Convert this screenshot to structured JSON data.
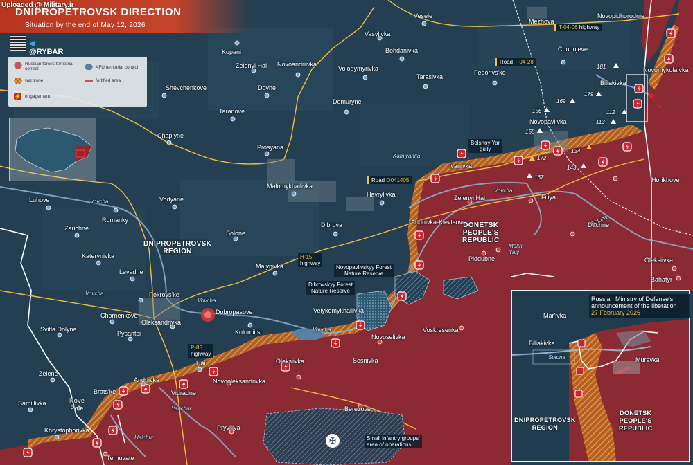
{
  "header": {
    "title": "DNIPROPETROVSK DIRECTION",
    "subtitle": "Situation by the end of May 12, 2026"
  },
  "watermark": "Uploaded @ Military.ir",
  "brand": {
    "handle": "@RYBAR",
    "icon": "telegram-icon"
  },
  "legend": {
    "russian_forces": "Russian forces territorial control",
    "afu": "AFU territorial control",
    "war_zone": "war zone",
    "fortified": "fortified area",
    "engagement": "engagement"
  },
  "colors": {
    "russian": "#8b2a33",
    "afu": "#243f51",
    "war_zone": "#d98a2b",
    "roads": "#f0c040",
    "header": "#c5432a"
  },
  "settlements": {
    "vesele": "Vesele",
    "mezhova": "Mezhova",
    "novopidhorodnie": "Novopidhorodnie",
    "vasylivka": "Vasylivka",
    "kopani": "Kopani",
    "bohdanivka": "Bohdanivka",
    "chuhujeve": "Chuhujeve",
    "novomykolaivka": "Novomykolaivka",
    "zelenyi_hai_n": "Zelenyi Hai",
    "novoandriivka": "Novoandriivka",
    "volodymyrivka": "Volodymyrivka",
    "fedorivs_ke": "Fedorivs'ke",
    "tarasivka": "Tarasivka",
    "biliakivka": "Biliakivka",
    "shevchenkove": "Shevchenkove",
    "dovhe": "Dovhe",
    "demuryne": "Demuryne",
    "taranove": "Taranove",
    "novopavlivka": "Novopavlivka",
    "chaplyne": "Chaplyne",
    "prosyana": "Prosyana",
    "ivanivka": "Ivanivka",
    "horikhove": "Horikhove",
    "malomykhailivka": "Malomykhailivka",
    "havrylivka": "Havrylivka",
    "zelenyi_hai_s": "Zelenyi Hai",
    "filiya": "Filiya",
    "luhove": "Luhove",
    "vodyane": "Vodyane",
    "romanky": "Romanky",
    "zarichne": "Zarichne",
    "solone": "Solone",
    "dibrova": "Dibrova",
    "andriivka_klevtsove": "Andriivka-Klevtsove",
    "dachne": "Dachne",
    "katerynivka": "Katerynivka",
    "malynivka": "Malynivka",
    "oleksiivka_e": "Oleksiivka",
    "levadne": "Levadne",
    "piddubne": "Piddubne",
    "bahatyr": "Bahatyr",
    "pokrovs_ke": "Pokrovs'ke",
    "chornenkove": "Chornenkove",
    "dobropasove": "Dobropasove",
    "velykomykhailivka": "Velykomykhailivka",
    "oleksandrivka": "Oleksandrivka",
    "voskresenka": "Voskresenka",
    "svitla_dolyna": "Svitla Dolyna",
    "pysantsi": "Pysantsi",
    "kolomiitsi": "Kolomiitsi",
    "novoselivka": "Novoselivka",
    "oleksiivka_s": "Oleksiivka",
    "sosnivka": "Sosnivka",
    "zelene": "Zelene",
    "hai": "Hai",
    "andriivka_s": "Andriivka",
    "novooleksandrivka": "Novooleksandrivka",
    "samiilivka": "Samiilivka",
    "brats_ke": "Brats'ke",
    "vidradne": "Vidradne",
    "nove_pole": "Nove\nPole",
    "berezove": "Berezove",
    "khrystophorivka": "Khrystophorivka",
    "pryvillya": "Pryvillya",
    "ternuvate": "Ternuvate"
  },
  "regions": {
    "dnipropetrovsk": "DNIPROPETROVSK\nREGION",
    "donetsk": "DONETSK\nPEOPLE'S\nREPUBLIC"
  },
  "rivers": {
    "vovcha_1": "Vovcha",
    "vovcha_2": "Vovcha",
    "vovcha_3": "Vovcha",
    "vovcha_4": "Vovcha",
    "vovcha_5": "Vovcha",
    "kamyanka": "Kam'yanka",
    "mokri_yaly": "Mokri\nYaly",
    "solona": "Solona",
    "yanchur": "Yanchur",
    "haichur": "Haichur"
  },
  "roads": {
    "t0406_prefix": "",
    "t0406": "T-04-06",
    "t0406_suffix": " highway",
    "t0428_prefix": "Road ",
    "t0428": "T-04-28",
    "o041405_prefix": "Road ",
    "o041405": "O041405",
    "h15": "H-15",
    "h15_suffix": "highway",
    "p85": "P-85",
    "p85_suffix": "highway"
  },
  "annotations": {
    "bolshoy_yar": "Bolshoy Yar\ngully",
    "novopavlivskyy": "Novopavlivskyy Forest\nNature Reserve",
    "dibrovskyy": "Dibrovskyy Forest\nNature Reserve",
    "infantry": "Small infantry groups'\narea of operations"
  },
  "heights": {
    "h181": "181",
    "h169": "169",
    "h179": "179",
    "h156": "156",
    "h112": "112",
    "h113": "113",
    "h158": "158",
    "h134": "134",
    "h172": "172",
    "h143": "143",
    "h167": "167"
  },
  "inset": {
    "callout": "Russian Ministry of Defense's announcement of the liberation",
    "date": "27 February 2026",
    "marivka": "Mar'ivka",
    "biliakivka": "Biliakivka",
    "muravka": "Muravka",
    "solona": "Solona",
    "dnipro_region": "DNIPROPETROVSK\nREGION",
    "donetsk_region": "DONETSK\nPEOPLE'S\nREPUBLIC"
  }
}
